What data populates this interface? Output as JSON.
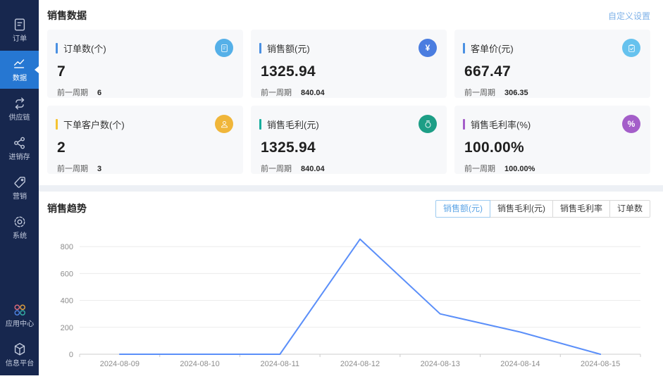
{
  "sidebar": {
    "items": [
      {
        "label": "订单",
        "icon": "order-doc-icon",
        "active": false
      },
      {
        "label": "数据",
        "icon": "data-chart-icon",
        "active": true
      },
      {
        "label": "供应链",
        "icon": "supply-chain-icon",
        "active": false
      },
      {
        "label": "进销存",
        "icon": "inventory-icon",
        "active": false
      },
      {
        "label": "营销",
        "icon": "marketing-tag-icon",
        "active": false
      },
      {
        "label": "系统",
        "icon": "system-gear-icon",
        "active": false
      },
      {
        "label": "应用中心",
        "icon": "app-center-icon",
        "active": false
      },
      {
        "label": "信息平台",
        "icon": "info-platform-icon",
        "active": false
      }
    ],
    "bg_color": "#17274e",
    "active_color": "#2677d2"
  },
  "sales_data": {
    "title": "销售数据",
    "settings_link": "自定义设置",
    "prev_label": "前一周期",
    "cards": [
      {
        "title": "订单数(个)",
        "value": "7",
        "prev": "6",
        "accent_color": "#4a90e2",
        "icon_color": "#55b0e8",
        "icon": "order-icon"
      },
      {
        "title": "销售额(元)",
        "value": "1325.94",
        "prev": "840.04",
        "accent_color": "#4a90e2",
        "icon_color": "#4a7de0",
        "icon": "yuan-icon"
      },
      {
        "title": "客单价(元)",
        "value": "667.47",
        "prev": "306.35",
        "accent_color": "#4a90e2",
        "icon_color": "#66c2ee",
        "icon": "clipboard-icon"
      },
      {
        "title": "下单客户数(个)",
        "value": "2",
        "prev": "3",
        "accent_color": "#f5c332",
        "icon_color": "#f0b63a",
        "icon": "customer-icon"
      },
      {
        "title": "销售毛利(元)",
        "value": "1325.94",
        "prev": "840.04",
        "accent_color": "#18ae9e",
        "icon_color": "#1d9e86",
        "icon": "money-bag-icon"
      },
      {
        "title": "销售毛利率(%)",
        "value": "100.00%",
        "prev": "100.00%",
        "accent_color": "#a45ec9",
        "icon_color": "#a45ec9",
        "icon": "percent-icon"
      }
    ]
  },
  "trend": {
    "title": "销售趋势",
    "buttons": [
      {
        "label": "销售额(元)",
        "active": true
      },
      {
        "label": "销售毛利(元)",
        "active": false
      },
      {
        "label": "销售毛利率",
        "active": false
      },
      {
        "label": "订单数",
        "active": false
      }
    ]
  },
  "chart_data": {
    "type": "line",
    "title": "销售趋势",
    "x": [
      "2024-08-09",
      "2024-08-10",
      "2024-08-11",
      "2024-08-12",
      "2024-08-13",
      "2024-08-14",
      "2024-08-15"
    ],
    "series": [
      {
        "name": "销售额(元)",
        "values": [
          0,
          0,
          0,
          855,
          300,
          165,
          0
        ]
      }
    ],
    "yticks": [
      0,
      200,
      400,
      600,
      800
    ],
    "ylim": [
      0,
      900
    ],
    "xlabel": "",
    "ylabel": "",
    "grid": true,
    "legend_position": "none",
    "line_color": "#5b8ff9",
    "grid_color": "#ebebeb",
    "axis_color": "#cccccc",
    "tick_label_color": "#8c8c8c"
  }
}
